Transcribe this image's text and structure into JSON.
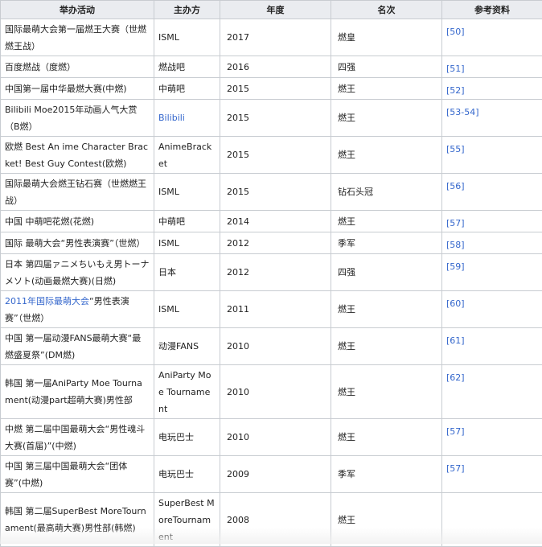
{
  "headers": [
    "举办活动",
    "主办方",
    "年度",
    "名次",
    "参考资料"
  ],
  "rows": [
    {
      "event": "国际最萌大会第一届燃王大赛（世燃燃王战）",
      "org": "ISML",
      "year": "2017",
      "rank": "燃皇",
      "ref": "[50]"
    },
    {
      "event": "百度燃战（度燃）",
      "org": "燃战吧",
      "year": "2016",
      "rank": "四强",
      "ref": "[51]"
    },
    {
      "event": "中国第一届中华最燃大赛(中燃)",
      "org": "中萌吧",
      "year": "2015",
      "rank": "燃王",
      "ref": "[52]"
    },
    {
      "event": "Bilibili Moe2015年动画人气大赏（B燃）",
      "org": "Bilibili",
      "year": "2015",
      "rank": "燃王",
      "ref": "[53-54]"
    },
    {
      "event": "欧燃 Best An ime Character Bracket! Best Guy Contest(欧燃)",
      "org": "AnimeBracket",
      "year": "2015",
      "rank": "燃王",
      "ref": "[55]"
    },
    {
      "event": "国际最萌大会燃王钻石赛（世燃燃王战）",
      "org": "ISML",
      "year": "2015",
      "rank": "钻石头冠",
      "ref": "[56]"
    },
    {
      "event": "中国 中萌吧花燃(花燃)",
      "org": "中萌吧",
      "year": "2014",
      "rank": "燃王",
      "ref": "[57]"
    },
    {
      "event": "国际 最萌大会“男性表演赛”（世燃）",
      "org": "ISML",
      "year": "2012",
      "rank": "季军",
      "ref": "[58]"
    },
    {
      "event": "日本 第四届ァニメちいもえ男トーナメソト(动画最燃大赛)(日燃)",
      "org": "日本",
      "year": "2012",
      "rank": "四强",
      "ref": "[59]"
    },
    {
      "event_link": "2011年国际最萌大会",
      "event": "“男性表演赛”（世燃）",
      "org": "ISML",
      "year": "2011",
      "rank": "燃王",
      "ref": "[60]"
    },
    {
      "event": "中国 第一届动漫FANS最萌大赛“最燃盛夏祭”(DM燃)",
      "org": "动漫FANS",
      "year": "2010",
      "rank": "燃王",
      "ref": "[61]"
    },
    {
      "event": "韩国 第一届AniParty Moe Tournament(动漫part超萌大赛)男性部",
      "org": "AniParty Moe Tournament",
      "year": "2010",
      "rank": "燃王",
      "ref": "[62]"
    },
    {
      "event": "中燃 第二届中国最萌大会“男性魂斗大赛(首届)”(中燃)",
      "org": "电玩巴士",
      "year": "2010",
      "rank": "燃王",
      "ref": "[57]"
    },
    {
      "event": "中国 第三届中国最萌大会“团体赛”(中燃)",
      "org": "电玩巴士",
      "year": "2009",
      "rank": "季军",
      "ref": "[57]"
    },
    {
      "event": "韩国 第二届SuperBest MoreTournament(最高萌大赛)男性部(韩燃)",
      "org": "SuperBest MoreTournament",
      "year": "2008",
      "rank": "燃王",
      "ref": ""
    }
  ],
  "colors": {
    "link": "#3366cc",
    "header_bg": "#eaecf0",
    "border": "#c8ccd1"
  }
}
